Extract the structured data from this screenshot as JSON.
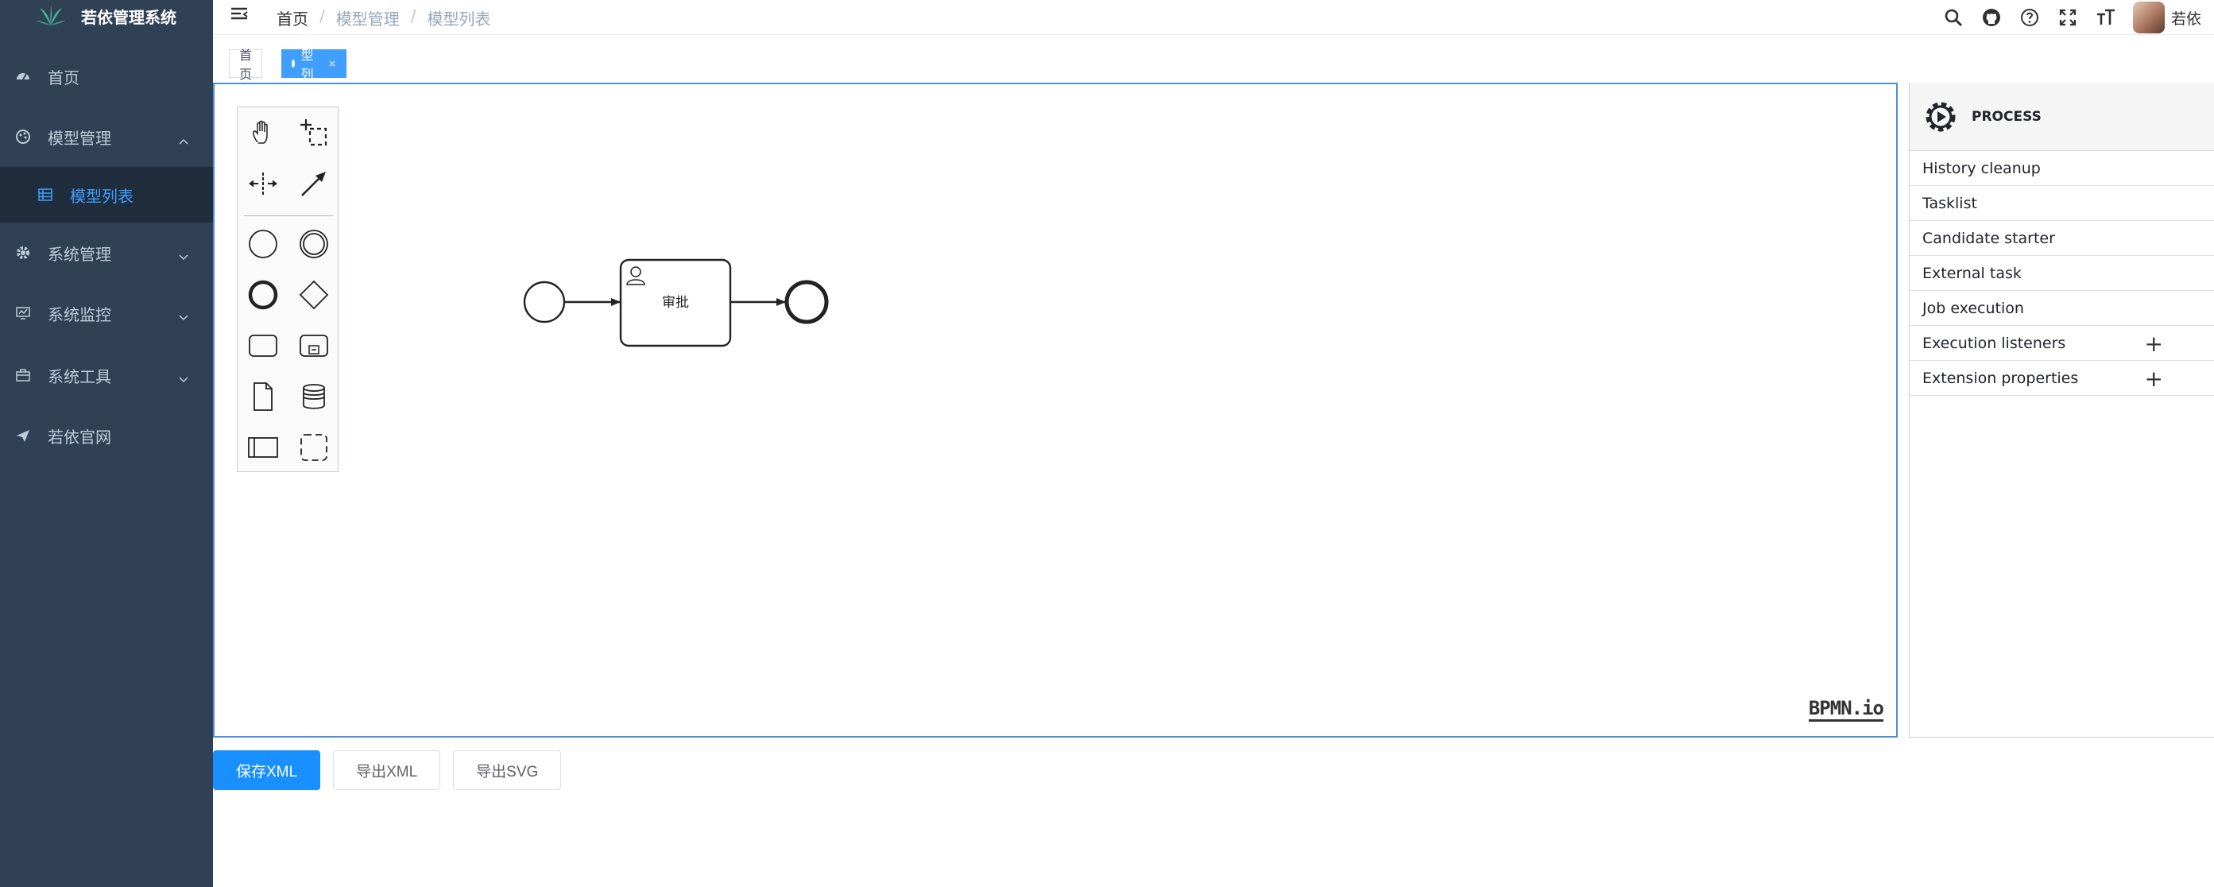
{
  "app": {
    "title": "若依管理系统"
  },
  "sidebar": {
    "items": [
      {
        "label": "首页",
        "icon": "dashboard-icon"
      },
      {
        "label": "模型管理",
        "icon": "palette-icon",
        "expanded": true,
        "children": [
          {
            "label": "模型列表",
            "icon": "table-icon",
            "active": true
          }
        ]
      },
      {
        "label": "系统管理",
        "icon": "gear-icon"
      },
      {
        "label": "系统监控",
        "icon": "monitor-icon"
      },
      {
        "label": "系统工具",
        "icon": "toolbox-icon"
      },
      {
        "label": "若依官网",
        "icon": "send-icon"
      }
    ]
  },
  "navbar": {
    "breadcrumb": [
      "首页",
      "模型管理",
      "模型列表"
    ],
    "username": "若依"
  },
  "tags": [
    {
      "label": "首页",
      "active": false
    },
    {
      "label": "模型列表",
      "active": true,
      "close": "×"
    }
  ],
  "diagram": {
    "task_label": "审批",
    "watermark": "BPMN.io"
  },
  "properties": {
    "header": "PROCESS",
    "groups": [
      "History cleanup",
      "Tasklist",
      "Candidate starter",
      "External task",
      "Job execution",
      "Execution listeners",
      "Extension properties"
    ],
    "add_symbol": "+"
  },
  "buttons": {
    "save": "保存XML",
    "export_xml": "导出XML",
    "export_svg": "导出SVG"
  },
  "colors": {
    "sidebar_bg": "#304156",
    "submenu_bg": "#1f2d3d",
    "accent": "#409eff",
    "primary_button": "#1890ff"
  }
}
